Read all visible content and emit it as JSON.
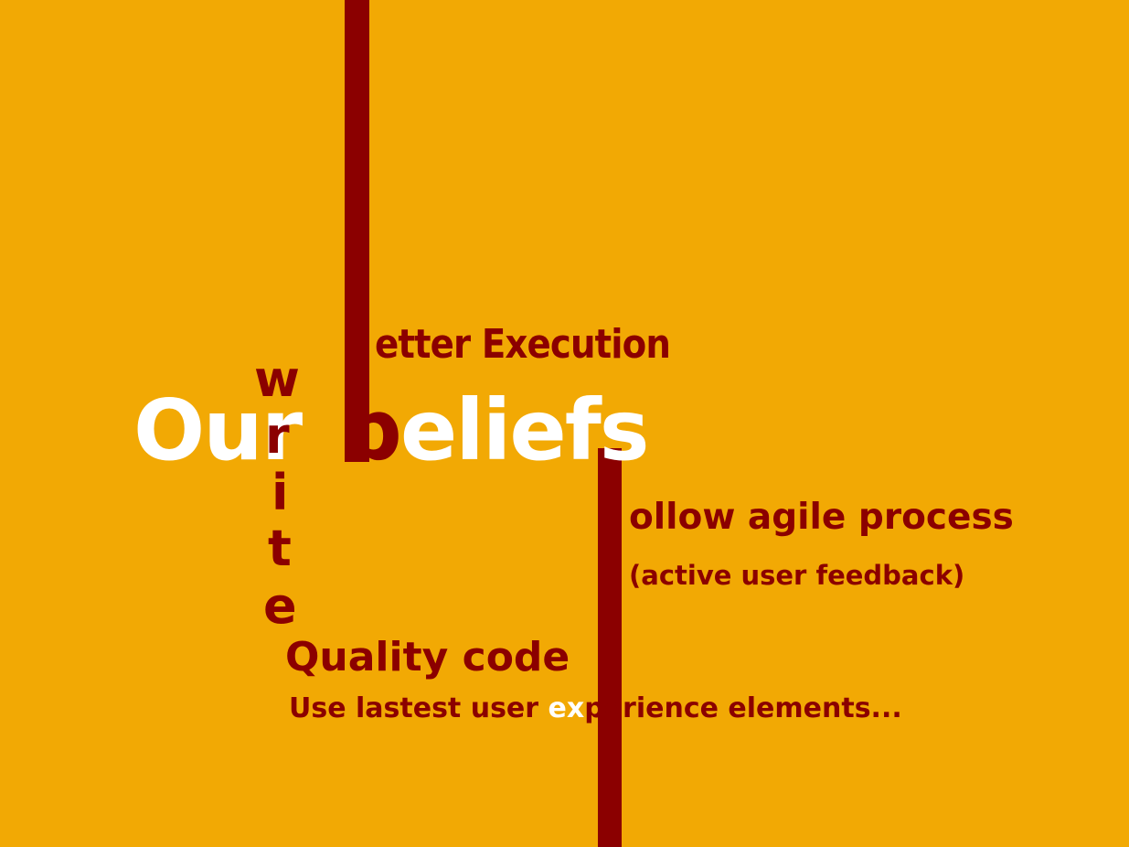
{
  "colors": {
    "background": "#F2A904",
    "accent": "#8B0000",
    "highlight": "#FFFFFF"
  },
  "headline": {
    "our": "Our",
    "b": "b",
    "eliefs": "eliefs"
  },
  "vertical_word": [
    "w",
    "r",
    "i",
    "t",
    "e"
  ],
  "lines": {
    "better_execution": "etter Execution",
    "agile": "ollow agile process",
    "feedback": "(active user feedback)",
    "quality": "Quality code",
    "ux_before": "Use lastest user ",
    "ux_highlight": "ex",
    "ux_after": "perience elements..."
  }
}
